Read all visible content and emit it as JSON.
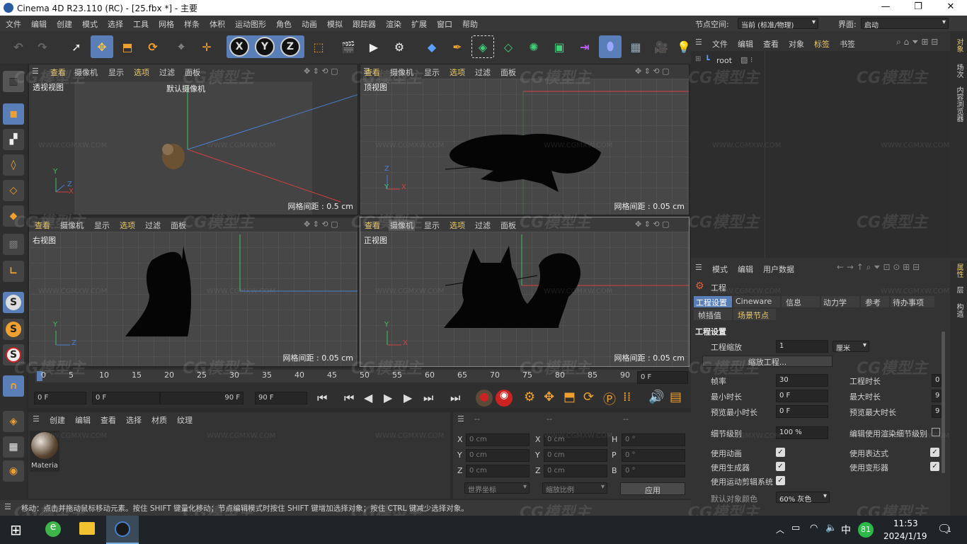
{
  "titlebar": {
    "title": "Cinema 4D R23.110 (RC) - [25.fbx *] - 主要",
    "minimize": "—",
    "maximize": "❐",
    "close": "✕"
  },
  "menu": [
    "文件",
    "编辑",
    "创建",
    "模式",
    "选择",
    "工具",
    "网格",
    "样条",
    "体积",
    "运动图形",
    "角色",
    "动画",
    "模拟",
    "跟踪器",
    "渲染",
    "扩展",
    "窗口",
    "帮助"
  ],
  "node_space": {
    "label": "节点空间:",
    "value": "当前 (标准/物理)"
  },
  "layout": {
    "label": "界面:",
    "value": "启动"
  },
  "viewports": [
    {
      "menu": [
        "查看",
        "摄像机",
        "显示",
        "选项",
        "过滤",
        "面板"
      ],
      "name": "透视视图",
      "camera": "默认摄像机",
      "grid": "网格间距 : 0.5 cm"
    },
    {
      "menu": [
        "查看",
        "摄像机",
        "显示",
        "选项",
        "过滤",
        "面板"
      ],
      "name": "顶视图",
      "grid": "网格间距 : 0.05 cm"
    },
    {
      "menu": [
        "查看",
        "摄像机",
        "显示",
        "选项",
        "过滤",
        "面板"
      ],
      "name": "右视图",
      "grid": "网格间距 : 0.05 cm"
    },
    {
      "menu": [
        "查看",
        "摄像机",
        "显示",
        "选项",
        "过滤",
        "面板"
      ],
      "name": "正视图",
      "grid": "网格间距 : 0.05 cm"
    }
  ],
  "axes": {
    "x": "X",
    "y": "Y",
    "z": "Z"
  },
  "timeline": {
    "ticks": [
      "0",
      "5",
      "10",
      "15",
      "20",
      "25",
      "30",
      "35",
      "40",
      "45",
      "50",
      "55",
      "60",
      "65",
      "70",
      "75",
      "80",
      "85",
      "90"
    ],
    "end_frame": "0 F",
    "start": "0 F",
    "range_start": "0 F",
    "range_end": "90 F",
    "end": "90 F"
  },
  "material_manager": {
    "menu": [
      "创建",
      "编辑",
      "查看",
      "选择",
      "材质",
      "纹理"
    ],
    "materials": [
      {
        "name": "Materia"
      }
    ]
  },
  "coordinates": {
    "headers": [
      "--",
      "--",
      "--"
    ],
    "rows": [
      {
        "a": "X",
        "av": "0 cm",
        "b": "X",
        "bv": "0 cm",
        "c": "H",
        "cv": "0 °"
      },
      {
        "a": "Y",
        "av": "0 cm",
        "b": "Y",
        "bv": "0 cm",
        "c": "P",
        "cv": "0 °"
      },
      {
        "a": "Z",
        "av": "0 cm",
        "b": "Z",
        "bv": "0 cm",
        "c": "B",
        "cv": "0 °"
      }
    ],
    "world": "世界坐标",
    "scale": "缩放比例",
    "apply": "应用"
  },
  "status": "移动：点击并拖动鼠标移动元素。按住 SHIFT 键量化移动；节点编辑模式时按住 SHIFT 键增加选择对象；按住 CTRL 键减少选择对象。",
  "object_manager": {
    "menu": [
      "文件",
      "编辑",
      "查看",
      "对象",
      "标签",
      "书签"
    ],
    "items": [
      {
        "name": "root"
      }
    ],
    "side_tabs": [
      "对象",
      "场次",
      "内容浏览器"
    ]
  },
  "attributes": {
    "menu": [
      "模式",
      "编辑",
      "用户数据"
    ],
    "title": "工程",
    "tabs": [
      "工程设置",
      "Cineware",
      "信息",
      "动力学",
      "参考",
      "待办事项"
    ],
    "tabs2": [
      "帧插值",
      "场景节点"
    ],
    "section": "工程设置",
    "scale_label": "工程缩放",
    "scale_value": "1",
    "scale_unit": "厘米",
    "scale_btn": "缩放工程...",
    "fps_label": "帧率",
    "fps_value": "30",
    "duration_label": "工程时长",
    "duration_value": "0",
    "min_label": "最小时长",
    "min_value": "0 F",
    "max_label": "最大时长",
    "max_value": "9",
    "pmin_label": "预览最小时长",
    "pmin_value": "0 F",
    "pmax_label": "预览最大时长",
    "pmax_value": "9",
    "lod_label": "细节级别",
    "lod_value": "100 %",
    "render_lod_label": "编辑使用渲染细节级别",
    "checks": [
      {
        "label": "使用动画",
        "checked": true
      },
      {
        "label": "使用表达式",
        "checked": true
      },
      {
        "label": "使用生成器",
        "checked": true
      },
      {
        "label": "使用变形器",
        "checked": true
      },
      {
        "label": "使用运动剪辑系统",
        "checked": true
      }
    ],
    "default_color_label": "默认对象颜色",
    "default_color_value": "60% 灰色",
    "side_tabs": [
      "属性",
      "层",
      "构造"
    ]
  },
  "watermark": {
    "text": "CG模型主",
    "url": "WWW.CGMXW.COM"
  },
  "taskbar": {
    "time": "11:53",
    "date": "2024/1/19",
    "ime": "中",
    "badge": "81",
    "notif": "1"
  },
  "colors": {
    "accent": "#5a7fb8",
    "highlight": "#e8c86a",
    "bg": "#2b2b2b"
  }
}
